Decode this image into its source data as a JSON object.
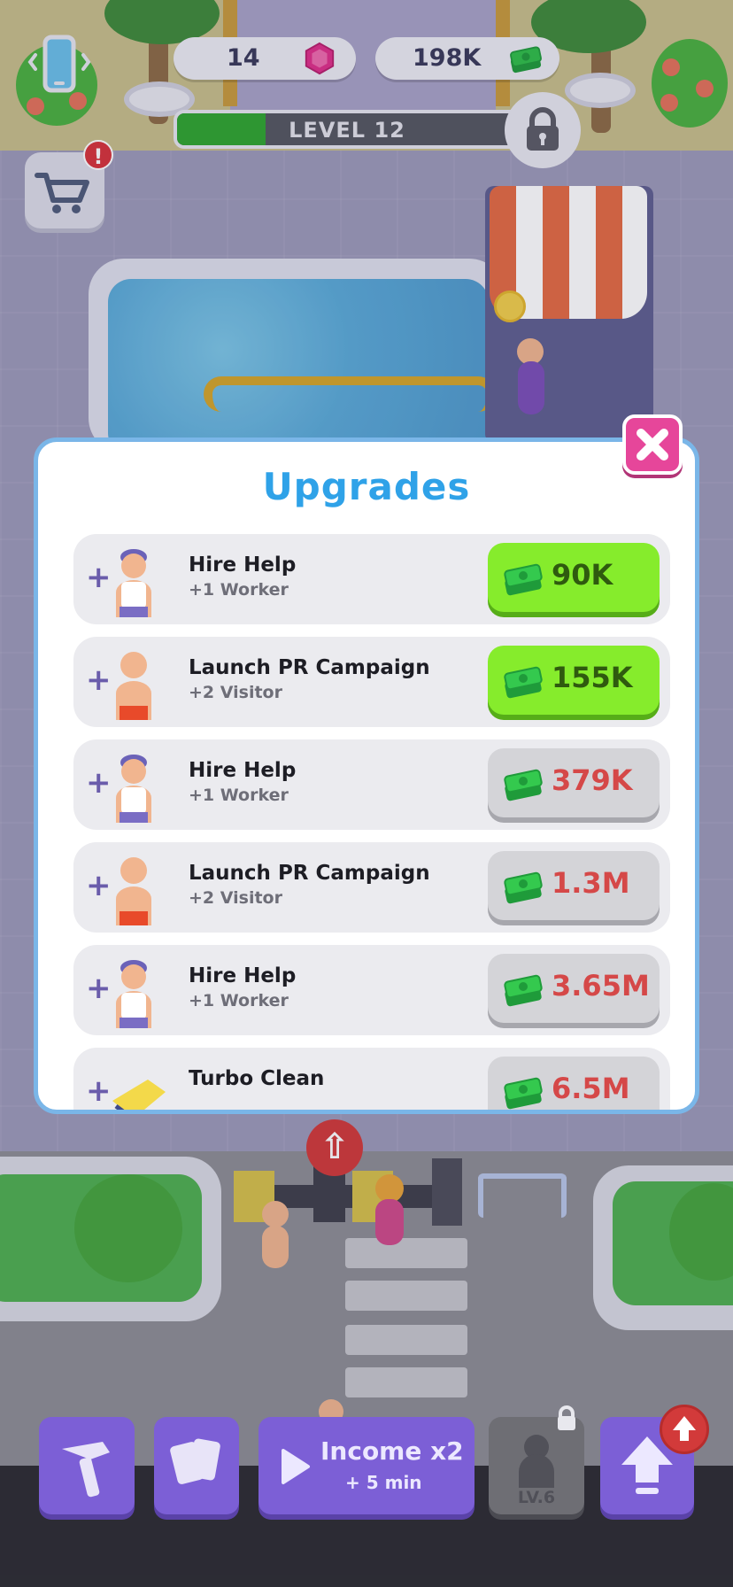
{
  "hud": {
    "gems": "14",
    "cash": "198K",
    "level_label": "LEVEL 12",
    "level_progress": 0.26,
    "icons": {
      "phone": "phone-vibrate-icon",
      "gem": "gem-icon",
      "cash": "cash-stack-icon",
      "lock": "lock-icon",
      "cart": "shopping-cart-icon",
      "alert": "exclamation-icon"
    },
    "alert_mark": "!"
  },
  "modal": {
    "title": "Upgrades",
    "close_icon": "close-icon",
    "items": [
      {
        "title": "Hire Help",
        "subtitle": "+1 Worker",
        "price": "90K",
        "state": "active",
        "avatar": "worker"
      },
      {
        "title": "Launch PR Campaign",
        "subtitle": "+2 Visitor",
        "price": "155K",
        "state": "active",
        "avatar": "visitor"
      },
      {
        "title": "Hire Help",
        "subtitle": "+1 Worker",
        "price": "379K",
        "state": "inactive",
        "avatar": "worker"
      },
      {
        "title": "Launch PR Campaign",
        "subtitle": "+2 Visitor",
        "price": "1.3M",
        "state": "inactive",
        "avatar": "visitor"
      },
      {
        "title": "Hire Help",
        "subtitle": "+1 Worker",
        "price": "3.65M",
        "state": "inactive",
        "avatar": "worker"
      },
      {
        "title": "Turbo Clean",
        "subtitle": "",
        "price": "6.5M",
        "state": "inactive",
        "avatar": "cleaner"
      }
    ],
    "plus": "+"
  },
  "toolbar": {
    "income_title": "Income x2",
    "income_sub": "+ 5 min",
    "lv_label": "LV.6",
    "icons": [
      "hammer-icon",
      "cards-icon",
      "play-icon",
      "character-icon",
      "upgrade-arrow-icon"
    ]
  },
  "colors": {
    "accent_blue": "#2fa2e8",
    "buy_green": "#86ec2c",
    "price_red": "#d54848",
    "toolbar_purple": "#7c5fd6",
    "close_pink": "#e6469a"
  }
}
